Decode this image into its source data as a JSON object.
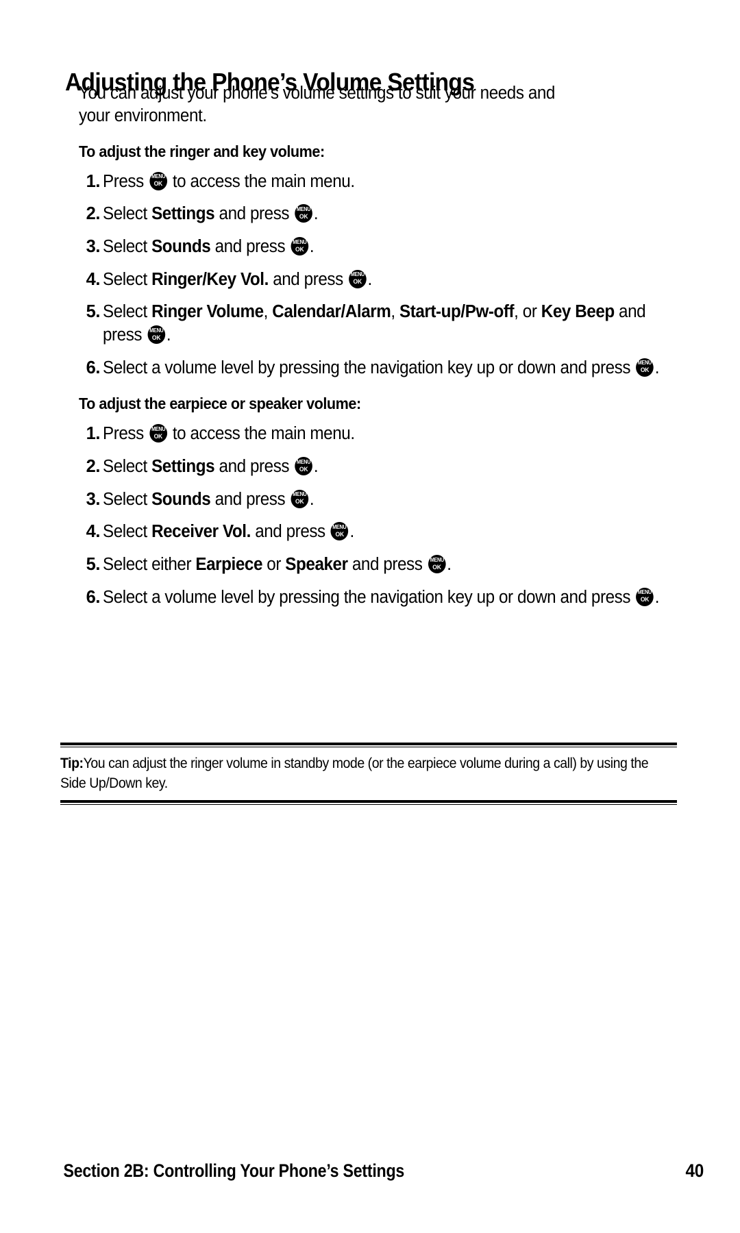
{
  "page": {
    "title": "Adjusting the Phone’s Volume Settings",
    "intro": "You can adjust your phone’s volume settings to suit your needs and your environment.",
    "page_number": "40",
    "footer_section": "Section 2B: Controlling Your Phone’s Settings"
  },
  "menu_key_icon": {
    "name": "menu-ok-key-icon",
    "top_label": "MENU",
    "bottom_label": "OK",
    "color": "#000000",
    "text_color": "#ffffff"
  },
  "section_ringer": {
    "subhead": "To adjust the ringer and key volume:",
    "steps": [
      {
        "num": "1.",
        "parts": [
          {
            "t": "Press ",
            "b": false
          },
          {
            "t": "MENUOK",
            "icon": true
          },
          {
            "t": " to access the main menu.",
            "b": false
          }
        ]
      },
      {
        "num": "2.",
        "parts": [
          {
            "t": "Select ",
            "b": false
          },
          {
            "t": "Settings",
            "b": true
          },
          {
            "t": " and press ",
            "b": false
          },
          {
            "t": "MENUOK",
            "icon": true
          },
          {
            "t": ".",
            "b": false
          }
        ]
      },
      {
        "num": "3.",
        "parts": [
          {
            "t": "Select ",
            "b": false
          },
          {
            "t": "Sounds",
            "b": true
          },
          {
            "t": " and press ",
            "b": false
          },
          {
            "t": "MENUOK",
            "icon": true
          },
          {
            "t": ".",
            "b": false
          }
        ]
      },
      {
        "num": "4.",
        "parts": [
          {
            "t": "Select ",
            "b": false
          },
          {
            "t": "Ringer/Key Vol.",
            "b": true
          },
          {
            "t": " and press ",
            "b": false
          },
          {
            "t": "MENUOK",
            "icon": true
          },
          {
            "t": ".",
            "b": false
          }
        ]
      },
      {
        "num": "5.",
        "parts": [
          {
            "t": "Select ",
            "b": false
          },
          {
            "t": "Ringer Volume",
            "b": true
          },
          {
            "t": ", ",
            "b": false
          },
          {
            "t": "Calendar/Alarm",
            "b": true
          },
          {
            "t": ", ",
            "b": false
          },
          {
            "t": "Start-up/Pw-off",
            "b": true
          },
          {
            "t": ", or ",
            "b": false
          },
          {
            "t": "Key Beep",
            "b": true
          },
          {
            "t": " and press ",
            "b": false
          },
          {
            "t": "MENUOK",
            "icon": true
          },
          {
            "t": ".",
            "b": false
          }
        ]
      },
      {
        "num": "6.",
        "parts": [
          {
            "t": "Select a volume level by pressing the navigation key up or down and press ",
            "b": false
          },
          {
            "t": "MENUOK",
            "icon": true
          },
          {
            "t": ".",
            "b": false
          }
        ]
      }
    ]
  },
  "section_earpiece": {
    "subhead": "To adjust the earpiece or speaker volume:",
    "steps": [
      {
        "num": "1.",
        "parts": [
          {
            "t": "Press ",
            "b": false
          },
          {
            "t": "MENUOK",
            "icon": true
          },
          {
            "t": " to access the main menu.",
            "b": false
          }
        ]
      },
      {
        "num": "2.",
        "parts": [
          {
            "t": "Select ",
            "b": false
          },
          {
            "t": "Settings",
            "b": true
          },
          {
            "t": " and press ",
            "b": false
          },
          {
            "t": "MENUOK",
            "icon": true
          },
          {
            "t": ".",
            "b": false
          }
        ]
      },
      {
        "num": "3.",
        "parts": [
          {
            "t": "Select ",
            "b": false
          },
          {
            "t": "Sounds",
            "b": true
          },
          {
            "t": " and press ",
            "b": false
          },
          {
            "t": "MENUOK",
            "icon": true
          },
          {
            "t": ".",
            "b": false
          }
        ]
      },
      {
        "num": "4.",
        "parts": [
          {
            "t": "Select ",
            "b": false
          },
          {
            "t": "Receiver Vol.",
            "b": true
          },
          {
            "t": " and press ",
            "b": false
          },
          {
            "t": "MENUOK",
            "icon": true
          },
          {
            "t": ".",
            "b": false
          }
        ]
      },
      {
        "num": "5.",
        "parts": [
          {
            "t": "Select either ",
            "b": false
          },
          {
            "t": "Earpiece",
            "b": true
          },
          {
            "t": " or ",
            "b": false
          },
          {
            "t": "Speaker",
            "b": true
          },
          {
            "t": " and press ",
            "b": false
          },
          {
            "t": "MENUOK",
            "icon": true
          },
          {
            "t": ".",
            "b": false
          }
        ]
      },
      {
        "num": "6.",
        "parts": [
          {
            "t": "Select a volume level by pressing the navigation key up or down and press ",
            "b": false
          },
          {
            "t": "MENUOK",
            "icon": true
          },
          {
            "t": ".",
            "b": false
          }
        ]
      }
    ]
  },
  "tip": {
    "label": "Tip:",
    "text": "You can adjust the ringer volume in standby mode (or the earpiece volume during a call) by using the Side Up/Down key."
  }
}
